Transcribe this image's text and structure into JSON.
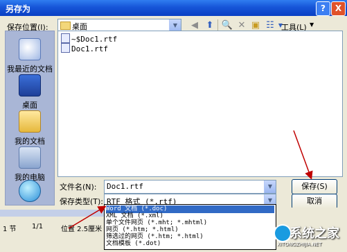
{
  "window": {
    "title": "另存为",
    "help_label": "?",
    "close_label": "X"
  },
  "toolbar": {
    "save_in_label": "保存位置(I):",
    "save_in_value": "桌面",
    "tools_label": "工具(L)"
  },
  "places": [
    {
      "label": "我最近的文档",
      "icon": "recent-documents-icon"
    },
    {
      "label": "桌面",
      "icon": "desktop-icon"
    },
    {
      "label": "我的文档",
      "icon": "my-documents-icon"
    },
    {
      "label": "我的电脑",
      "icon": "my-computer-icon"
    },
    {
      "label": "",
      "icon": "network-places-icon"
    }
  ],
  "files": [
    {
      "name": "~$Doc1.rtf"
    },
    {
      "name": "Doc1.rtf"
    }
  ],
  "form": {
    "filename_label": "文件名(N):",
    "filename_value": "Doc1.rtf",
    "filetype_label": "保存类型(T):",
    "filetype_value": "RTF 格式 (*.rtf)",
    "save_button": "保存(S)",
    "cancel_button": "取消"
  },
  "filetype_options": [
    "Word 文档 (*.doc)",
    "XML 文档 (*.xml)",
    "单个文件网页 (*.mht; *.mhtml)",
    "网页 (*.htm; *.html)",
    "筛选过的网页 (*.htm; *.html)",
    "文档模板 (*.dot)"
  ],
  "statusbar": {
    "section": "1 节",
    "page": "1/1",
    "position": "位置 2.5厘米"
  },
  "watermark": {
    "text": "系统之家",
    "sub": "XITONGZHIJIA.NET"
  },
  "colors": {
    "title_bar": "#0a3fc3",
    "dialog_bg": "#ece9d8",
    "selection": "#316ac5",
    "annotation": "#c00000"
  }
}
